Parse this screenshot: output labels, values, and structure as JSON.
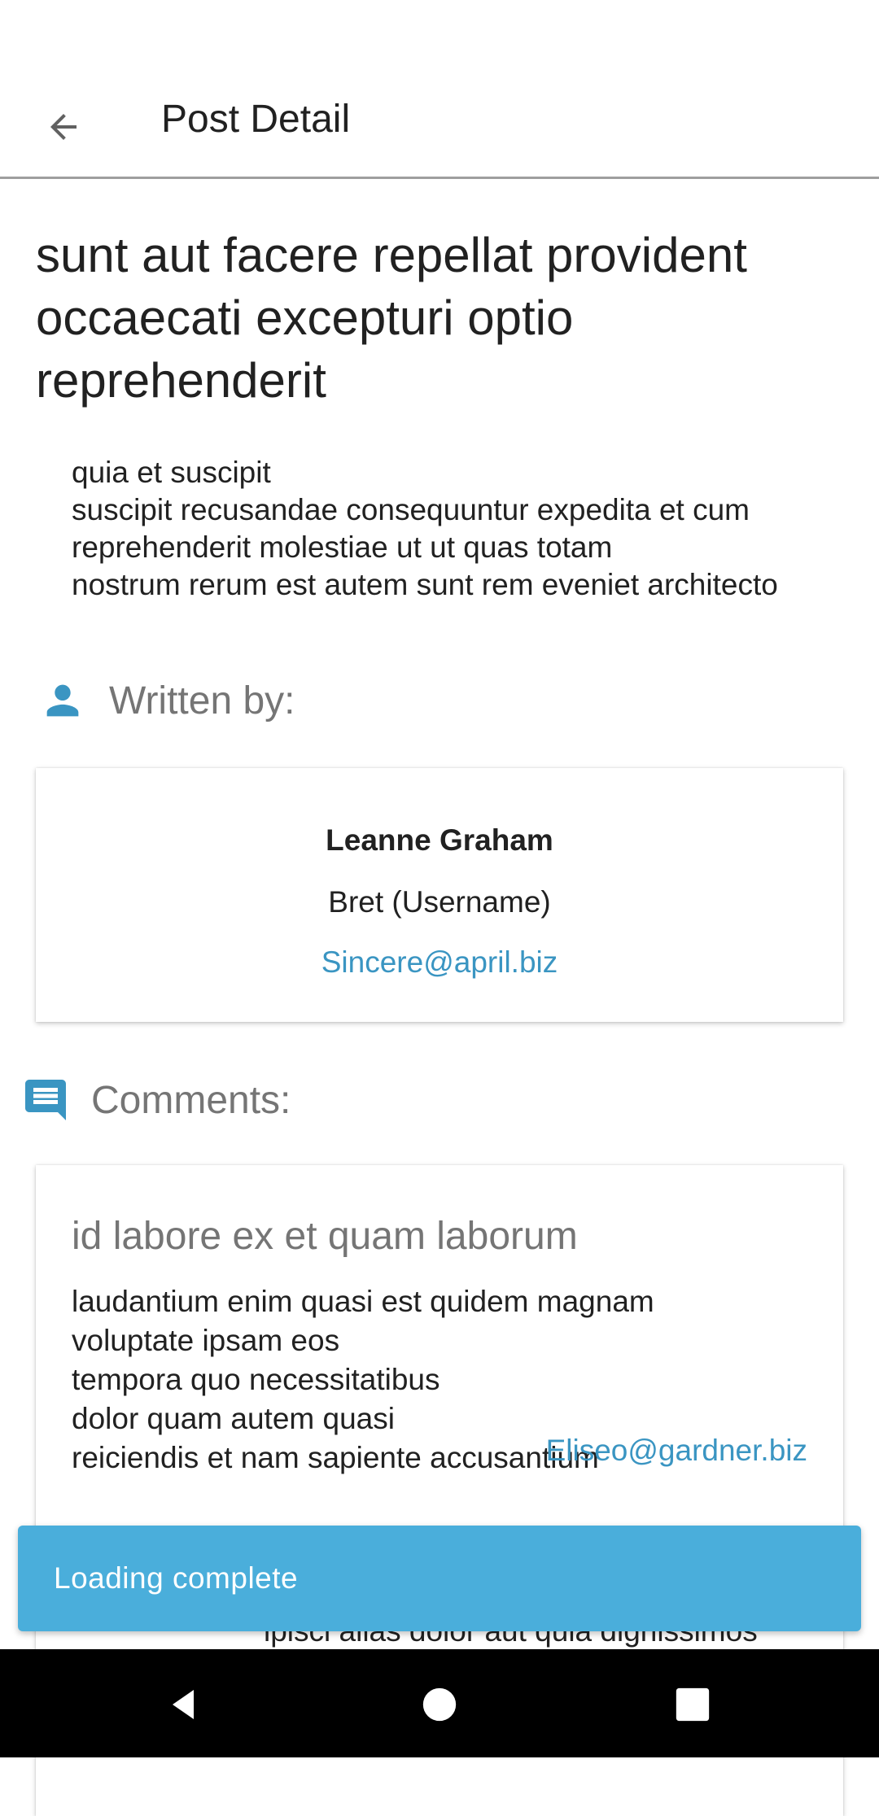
{
  "app_bar": {
    "title": "Post Detail",
    "back_icon": "arrow-back-icon"
  },
  "post": {
    "title": "sunt aut facere repellat provident occaecati excepturi optio reprehenderit",
    "body": "quia et suscipit\nsuscipit recusandae consequuntur expedita et cum\nreprehenderit molestiae ut ut quas totam\nnostrum rerum est autem sunt rem eveniet architecto"
  },
  "author_section": {
    "label": "Written by:",
    "icon": "person-icon",
    "name": "Leanne Graham",
    "username": "Bret (Username)",
    "email": "Sincere@april.biz"
  },
  "comments_section": {
    "label": "Comments:",
    "icon": "comment-icon",
    "comments": [
      {
        "name": "id labore ex et quam laborum",
        "body": "laudantium enim quasi est quidem magnam\nvoluptate ipsam eos\ntempora quo necessitatibus\ndolor quam autem quasi\nreiciendis et nam sapiente accusantium",
        "email": "Eliseo@gardner.biz"
      }
    ],
    "next_peek": "ipisci alias dolor aut quia dignissimos"
  },
  "snackbar": {
    "message": "Loading complete"
  },
  "colors": {
    "accent": "#3a95c2",
    "snackbar_bg": "#4aaedb",
    "divider": "#9e9e9e",
    "secondary_text": "#757575"
  }
}
